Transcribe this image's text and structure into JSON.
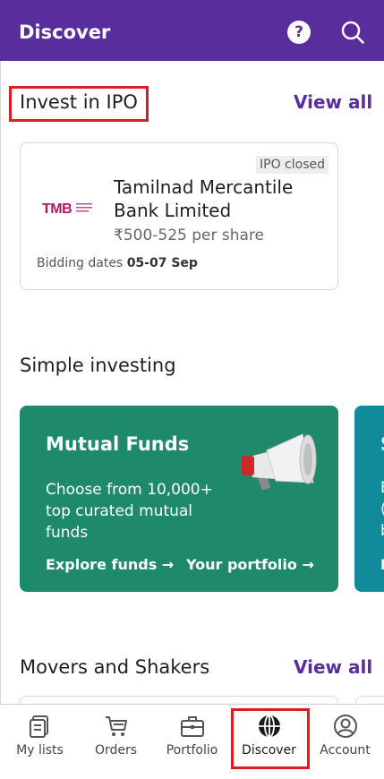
{
  "header": {
    "title": "Discover",
    "help_icon": "question-circle-icon",
    "help_glyph": "?",
    "search_icon": "search-icon",
    "bg_color": "#5a2d9c"
  },
  "ipo_section": {
    "title": "Invest in IPO",
    "view_all": "View all",
    "card": {
      "status": "IPO closed",
      "logo_text": "TMB",
      "company": "Tamilnad Mercantile Bank Limited",
      "price": "₹500-525 per share",
      "dates_label": "Bidding dates",
      "dates_value": "05-07 Sep"
    }
  },
  "simple_investing": {
    "title": "Simple investing",
    "card": {
      "title": "Mutual Funds",
      "description": "Choose from 10,000+ top curated mutual funds",
      "link_explore": "Explore funds",
      "link_portfolio": "Your portfolio",
      "arrow": "→",
      "icon": "megaphone-icon",
      "bg_color": "#1f8a6b"
    },
    "next_card": {
      "partial_title": "S",
      "partial_lines": [
        "E",
        "(",
        "b"
      ],
      "partial_link": "E",
      "bg_color": "#118a9a"
    }
  },
  "movers_section": {
    "title": "Movers and Shakers",
    "view_all": "View all"
  },
  "bottom_nav": {
    "items": [
      {
        "label": "My lists",
        "icon": "lists-icon"
      },
      {
        "label": "Orders",
        "icon": "cart-icon"
      },
      {
        "label": "Portfolio",
        "icon": "briefcase-icon"
      },
      {
        "label": "Discover",
        "icon": "globe-icon",
        "active": true
      },
      {
        "label": "Account",
        "icon": "account-icon"
      }
    ]
  },
  "colors": {
    "accent": "#5a2d9c",
    "highlight": "#e21b22"
  }
}
